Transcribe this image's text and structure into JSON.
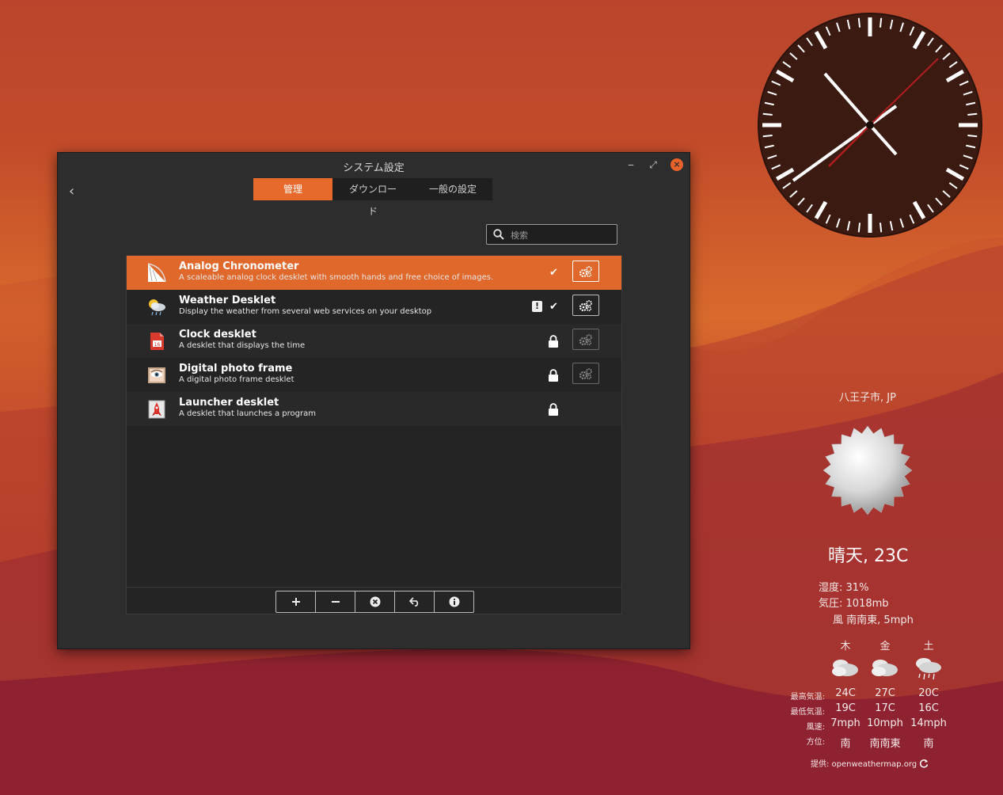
{
  "window": {
    "title": "システム設定",
    "minimize": "‒",
    "maximize": "⤢",
    "close": "×",
    "back": "‹",
    "tabs": [
      {
        "label": "管理",
        "active": true
      },
      {
        "label": "ダウンロード",
        "active": false
      },
      {
        "label": "一般の設定",
        "active": false
      }
    ],
    "search_placeholder": "検索",
    "desklets": [
      {
        "name": "Analog Chronometer",
        "description": "A scaleable analog clock desklet with smooth hands and free choice of images.",
        "status": "enabled",
        "selected": true
      },
      {
        "name": "Weather Desklet",
        "description": "Display the weather from several web services on your desktop",
        "status": "enabled-warning",
        "selected": false
      },
      {
        "name": "Clock desklet",
        "description": "A desklet that displays the time",
        "status": "locked",
        "selected": false
      },
      {
        "name": "Digital photo frame",
        "description": "A digital photo frame desklet",
        "status": "locked",
        "selected": false
      },
      {
        "name": "Launcher desklet",
        "description": "A desklet that launches a program",
        "status": "locked",
        "selected": false
      }
    ],
    "toolbar": [
      "add",
      "remove",
      "uninstall",
      "restore",
      "info"
    ]
  },
  "weather": {
    "location": "八王子市, JP",
    "condition": "晴天, 23C",
    "humidity_label": "湿度:",
    "humidity": "31%",
    "pressure_label": "気圧:",
    "pressure": "1018mb",
    "wind_label": "風",
    "wind": "南南東, 5mph",
    "forecast_labels": {
      "high": "最高気温:",
      "low": "最低気温:",
      "wind": "風速:",
      "dir": "方位:"
    },
    "forecast": [
      {
        "day": "木",
        "high": "24C",
        "low": "19C",
        "wind": "7mph",
        "dir": "南",
        "icon": "cloudy-icon"
      },
      {
        "day": "金",
        "high": "27C",
        "low": "17C",
        "wind": "10mph",
        "dir": "南南東",
        "icon": "cloudy-icon"
      },
      {
        "day": "土",
        "high": "20C",
        "low": "16C",
        "wind": "14mph",
        "dir": "南",
        "icon": "rain-icon"
      }
    ],
    "source": "提供: openweathermap.org"
  },
  "colors": {
    "accent": "#e0682a",
    "window_bg": "#2d2d2d",
    "list_bg": "#242424",
    "clock_face": "#3b1a12",
    "second_hand": "#b01e1e"
  }
}
